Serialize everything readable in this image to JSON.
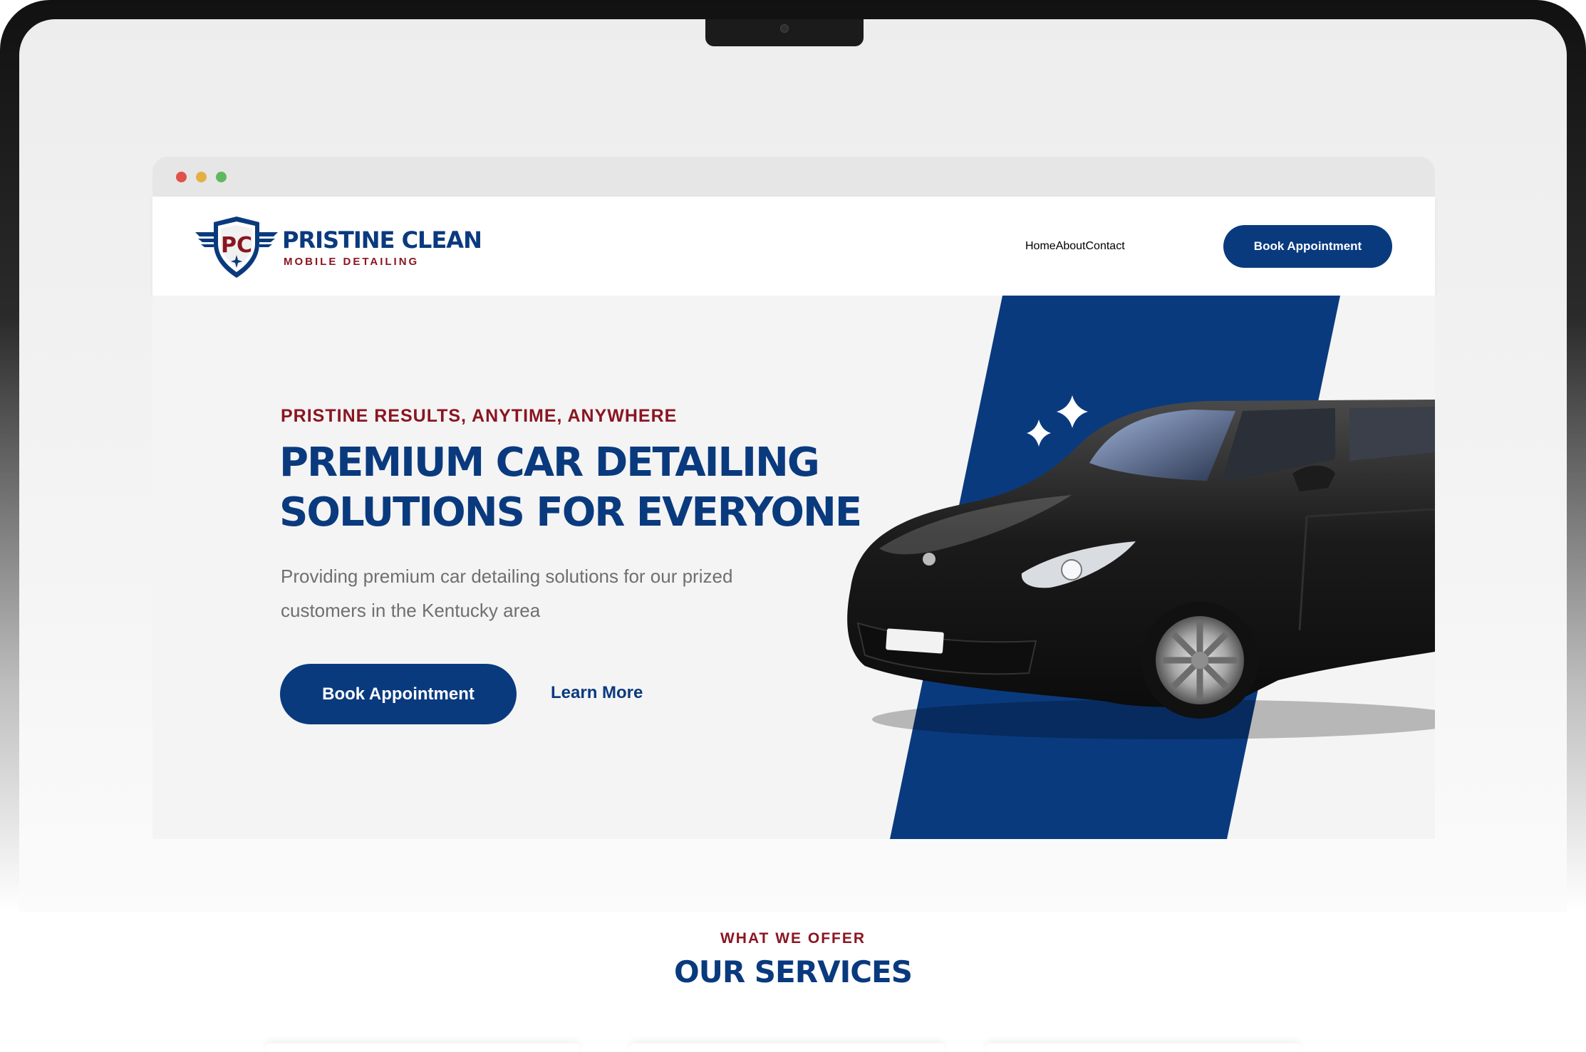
{
  "brand": {
    "initials": "PC",
    "name": "PRISTINE CLEAN",
    "tagline": "MOBILE DETAILING"
  },
  "nav": {
    "items": [
      {
        "label": "Home"
      },
      {
        "label": "About"
      },
      {
        "label": "Contact"
      }
    ],
    "cta_label": "Book Appointment"
  },
  "hero": {
    "eyebrow": "PRISTINE RESULTS, ANYTIME, ANYWHERE",
    "headline_line1": "PREMIUM CAR DETAILING",
    "headline_line2": "SOLUTIONS FOR EVERYONE",
    "subtext": "Providing premium car detailing solutions for our prized customers in the Kentucky area",
    "primary_button": "Book Appointment",
    "secondary_link": "Learn More"
  },
  "services": {
    "eyebrow": "WHAT WE OFFER",
    "title": "OUR SERVICES"
  },
  "colors": {
    "brand_blue": "#0a3a7e",
    "brand_red": "#8a1521",
    "hero_background": "#f4f4f4"
  },
  "icons": [
    "shield-logo-icon",
    "sparkle-icon",
    "window-close-dot",
    "window-minimize-dot",
    "window-maximize-dot"
  ]
}
